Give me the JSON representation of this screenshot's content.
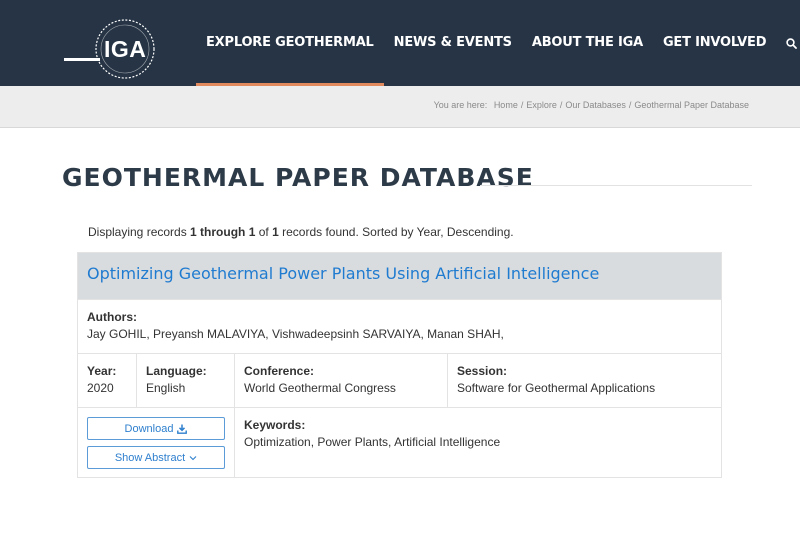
{
  "header": {
    "logo_text": "IGA",
    "logo_ring_text": "INTERNATIONAL GEOTHERMAL ASSOCIATION",
    "nav": [
      {
        "label": "EXPLORE GEOTHERMAL",
        "active": true
      },
      {
        "label": "NEWS & EVENTS"
      },
      {
        "label": "ABOUT THE IGA"
      },
      {
        "label": "GET INVOLVED"
      }
    ],
    "accent_color": "#e08a5d",
    "bg_color": "#263445"
  },
  "breadcrumb": {
    "prefix": "You are here:",
    "items": [
      "Home",
      "Explore",
      "Our Databases",
      "Geothermal Paper Database"
    ]
  },
  "page_title": "GEOTHERMAL PAPER DATABASE",
  "summary": {
    "pre": "Displaying records ",
    "range": "1 through 1",
    "of": " of ",
    "total": "1",
    "post": " records found. Sorted by Year, Descending."
  },
  "record": {
    "title": "Optimizing Geothermal Power Plants Using Artificial Intelligence",
    "authors_label": "Authors:",
    "authors": "Jay GOHIL, Preyansh MALAVIYA, Vishwadeepsinh SARVAIYA, Manan SHAH,",
    "year_label": "Year:",
    "year": "2020",
    "language_label": "Language:",
    "language": "English",
    "conference_label": "Conference:",
    "conference": "World Geothermal Congress",
    "session_label": "Session:",
    "session": "Software for Geothermal Applications",
    "keywords_label": "Keywords:",
    "keywords": "Optimization, Power Plants, Artificial Intelligence",
    "download_label": "Download",
    "abstract_label": "Show Abstract"
  }
}
